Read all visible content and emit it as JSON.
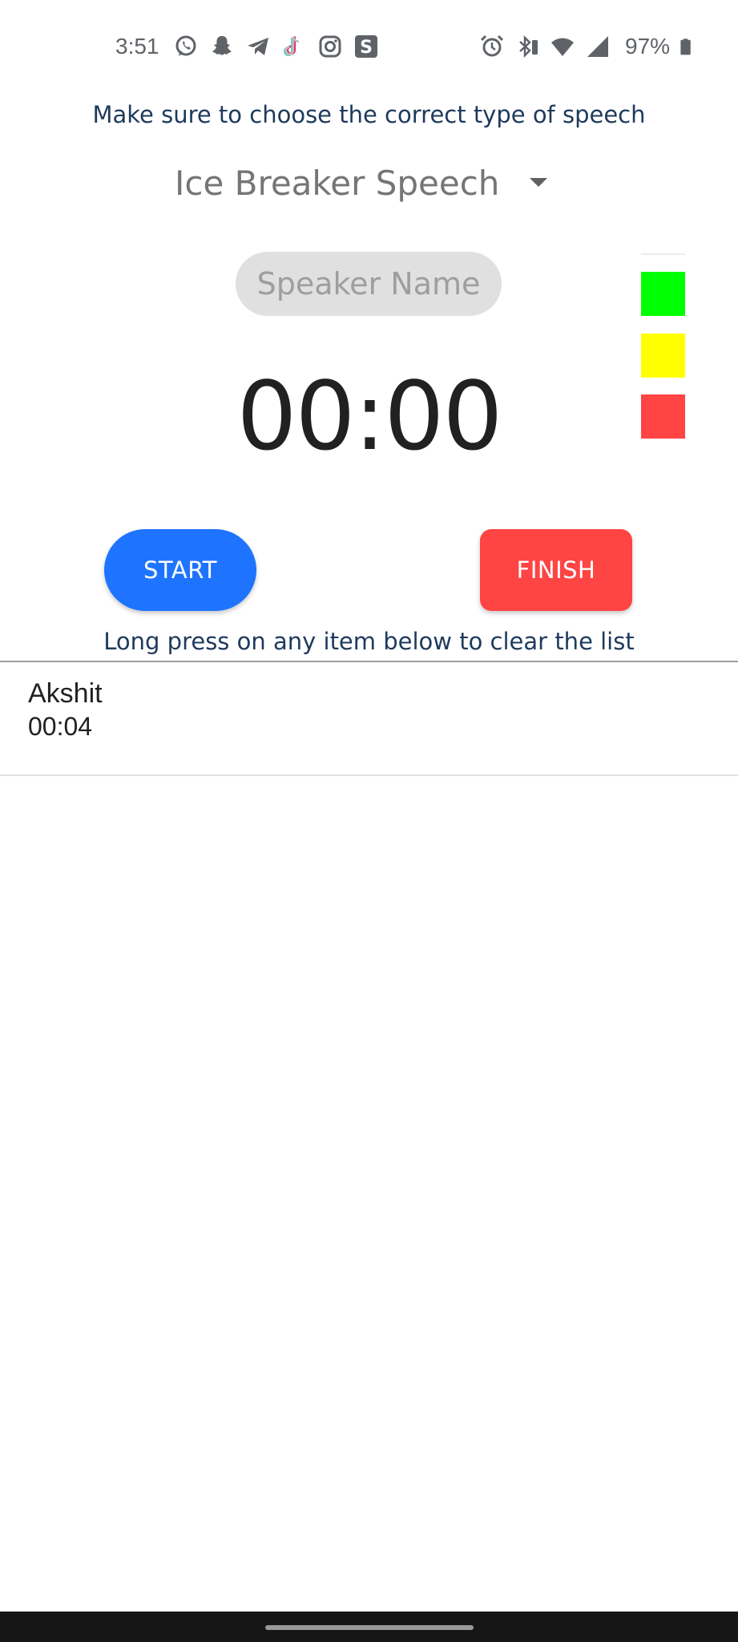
{
  "status_bar": {
    "time": "3:51",
    "battery_percent": "97%",
    "left_icons": [
      "whatsapp-icon",
      "snapchat-icon",
      "telegram-icon",
      "tiktok-icon",
      "instagram-icon",
      "s-app-icon"
    ],
    "right_icons": [
      "alarm-icon",
      "bluetooth-icon",
      "wifi-icon",
      "cell-signal-icon",
      "battery-icon"
    ]
  },
  "header": {
    "instruction": "Make sure to choose the correct type of speech"
  },
  "speech_type": {
    "selected": "Ice Breaker Speech"
  },
  "speaker": {
    "placeholder": "Speaker Name",
    "value": ""
  },
  "timer": {
    "display": "00:00"
  },
  "signals": {
    "colors": {
      "green": "#00ff00",
      "yellow": "#ffff00",
      "red": "#ff4444"
    }
  },
  "buttons": {
    "start_label": "START",
    "finish_label": "FINISH",
    "start_color": "#1e74ff",
    "finish_color": "#ff4444"
  },
  "list": {
    "instruction": "Long press on any item below to clear the list",
    "items": [
      {
        "name": "Akshit",
        "time": "00:04"
      }
    ]
  }
}
